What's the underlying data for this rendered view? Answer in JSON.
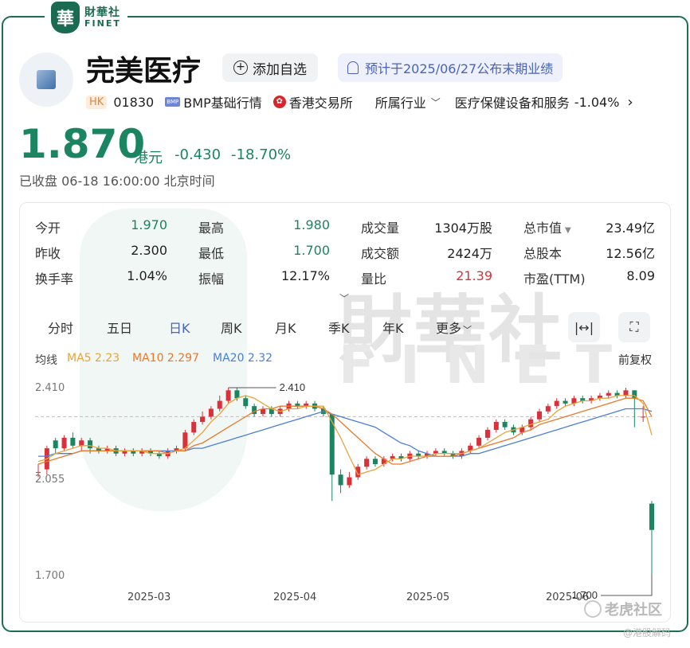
{
  "brand": {
    "seal": "華",
    "cn": "財華社",
    "en": "FINET"
  },
  "stock": {
    "name": "完美医疗",
    "watch_label": "添加自选",
    "notice": "预计于2025/06/27公布末期业绩",
    "market_tag": "HK",
    "code": "01830",
    "bmp_tag": "BMP",
    "bmp_label": "BMP基础行情",
    "exchange": "香港交易所",
    "industry_label": "所属行业",
    "industry": "医疗保健设备和服务",
    "industry_change": "-1.04%",
    "price": "1.870",
    "currency": "港元",
    "change": "-0.430",
    "change_pct": "-18.70%",
    "status": "已收盘  06-18 16:00:00 北京时间"
  },
  "stats": {
    "open_label": "今开",
    "open": "1.970",
    "high_label": "最高",
    "high": "1.980",
    "volume_label": "成交量",
    "volume": "1304万股",
    "mktcap_label": "总市值",
    "mktcap": "23.49亿",
    "prev_label": "昨收",
    "prev": "2.300",
    "low_label": "最低",
    "low": "1.700",
    "turnover_label": "成交额",
    "turnover": "2424万",
    "shares_label": "总股本",
    "shares": "12.56亿",
    "rate_label": "换手率",
    "rate": "1.04%",
    "amp_label": "振幅",
    "amp": "12.17%",
    "vr_label": "量比",
    "vr": "21.39",
    "pe_label": "市盈(TTM)",
    "pe": "8.09"
  },
  "tabs": [
    "分时",
    "五日",
    "日K",
    "周K",
    "月K",
    "季K",
    "年K",
    "更多"
  ],
  "active_tab": "日K",
  "ma": {
    "label": "均线",
    "ma5": "MA5 2.23",
    "ma10": "MA10 2.297",
    "ma20": "MA20 2.32",
    "adjust": "前复权"
  },
  "colors": {
    "up": "#d9303a",
    "down": "#1a8560",
    "ma5": "#e8a33a",
    "ma10": "#e8792a",
    "ma20": "#4a7fd8"
  },
  "chart_data": {
    "type": "candlestick",
    "y_ticks": [
      "2.410",
      "2.055",
      "1.700"
    ],
    "x_ticks": [
      "2025-03",
      "2025-04",
      "2025-05",
      "2025-06"
    ],
    "ylim": [
      1.7,
      2.41
    ],
    "max_label": "2.410",
    "min_label": "1.700",
    "candles": [
      [
        2.09,
        2.09,
        2.12,
        2.07
      ],
      [
        2.1,
        2.18,
        2.19,
        2.08
      ],
      [
        2.21,
        2.18,
        2.22,
        2.16
      ],
      [
        2.18,
        2.22,
        2.23,
        2.17
      ],
      [
        2.22,
        2.19,
        2.24,
        2.18
      ],
      [
        2.19,
        2.21,
        2.22,
        2.17
      ],
      [
        2.21,
        2.18,
        2.22,
        2.16
      ],
      [
        2.18,
        2.17,
        2.19,
        2.16
      ],
      [
        2.17,
        2.18,
        2.19,
        2.16
      ],
      [
        2.18,
        2.16,
        2.19,
        2.15
      ],
      [
        2.16,
        2.17,
        2.18,
        2.15
      ],
      [
        2.17,
        2.16,
        2.18,
        2.15
      ],
      [
        2.16,
        2.17,
        2.18,
        2.15
      ],
      [
        2.17,
        2.16,
        2.18,
        2.15
      ],
      [
        2.16,
        2.15,
        2.17,
        2.14
      ],
      [
        2.15,
        2.17,
        2.18,
        2.14
      ],
      [
        2.17,
        2.18,
        2.19,
        2.16
      ],
      [
        2.18,
        2.24,
        2.25,
        2.17
      ],
      [
        2.24,
        2.28,
        2.29,
        2.23
      ],
      [
        2.28,
        2.3,
        2.32,
        2.27
      ],
      [
        2.3,
        2.33,
        2.34,
        2.29
      ],
      [
        2.33,
        2.36,
        2.38,
        2.32
      ],
      [
        2.36,
        2.4,
        2.41,
        2.35
      ],
      [
        2.4,
        2.37,
        2.41,
        2.36
      ],
      [
        2.37,
        2.34,
        2.38,
        2.33
      ],
      [
        2.34,
        2.31,
        2.35,
        2.3
      ],
      [
        2.31,
        2.33,
        2.34,
        2.3
      ],
      [
        2.33,
        2.31,
        2.34,
        2.3
      ],
      [
        2.31,
        2.33,
        2.34,
        2.3
      ],
      [
        2.33,
        2.35,
        2.36,
        2.32
      ],
      [
        2.35,
        2.34,
        2.36,
        2.33
      ],
      [
        2.34,
        2.35,
        2.36,
        2.33
      ],
      [
        2.35,
        2.33,
        2.36,
        2.32
      ],
      [
        2.33,
        2.31,
        2.34,
        2.3
      ],
      [
        2.31,
        2.08,
        2.31,
        1.98
      ],
      [
        2.08,
        2.04,
        2.1,
        2.01
      ],
      [
        2.04,
        2.07,
        2.09,
        2.03
      ],
      [
        2.07,
        2.11,
        2.12,
        2.06
      ],
      [
        2.11,
        2.14,
        2.15,
        2.1
      ],
      [
        2.14,
        2.12,
        2.15,
        2.11
      ],
      [
        2.12,
        2.14,
        2.15,
        2.11
      ],
      [
        2.14,
        2.15,
        2.16,
        2.13
      ],
      [
        2.15,
        2.14,
        2.16,
        2.13
      ],
      [
        2.14,
        2.16,
        2.17,
        2.13
      ],
      [
        2.16,
        2.15,
        2.17,
        2.14
      ],
      [
        2.15,
        2.16,
        2.17,
        2.14
      ],
      [
        2.16,
        2.17,
        2.18,
        2.15
      ],
      [
        2.17,
        2.16,
        2.18,
        2.15
      ],
      [
        2.16,
        2.15,
        2.17,
        2.14
      ],
      [
        2.15,
        2.17,
        2.18,
        2.14
      ],
      [
        2.17,
        2.19,
        2.2,
        2.16
      ],
      [
        2.19,
        2.22,
        2.23,
        2.18
      ],
      [
        2.22,
        2.25,
        2.26,
        2.21
      ],
      [
        2.25,
        2.28,
        2.29,
        2.24
      ],
      [
        2.28,
        2.26,
        2.29,
        2.25
      ],
      [
        2.26,
        2.24,
        2.27,
        2.23
      ],
      [
        2.24,
        2.26,
        2.27,
        2.23
      ],
      [
        2.26,
        2.29,
        2.3,
        2.25
      ],
      [
        2.29,
        2.32,
        2.33,
        2.28
      ],
      [
        2.32,
        2.34,
        2.35,
        2.31
      ],
      [
        2.34,
        2.36,
        2.37,
        2.33
      ],
      [
        2.36,
        2.35,
        2.37,
        2.34
      ],
      [
        2.35,
        2.37,
        2.38,
        2.34
      ],
      [
        2.37,
        2.36,
        2.38,
        2.35
      ],
      [
        2.36,
        2.37,
        2.38,
        2.35
      ],
      [
        2.37,
        2.38,
        2.39,
        2.36
      ],
      [
        2.38,
        2.39,
        2.4,
        2.37
      ],
      [
        2.39,
        2.38,
        2.4,
        2.37
      ],
      [
        2.38,
        2.4,
        2.41,
        2.37
      ],
      [
        2.4,
        2.37,
        2.4,
        2.26
      ],
      [
        2.3,
        2.3,
        2.34,
        2.28
      ],
      [
        1.97,
        1.87,
        1.98,
        1.7
      ]
    ],
    "ma5": [
      2.13,
      2.14,
      2.16,
      2.17,
      2.18,
      2.19,
      2.19,
      2.18,
      2.18,
      2.17,
      2.17,
      2.17,
      2.17,
      2.16,
      2.16,
      2.16,
      2.17,
      2.18,
      2.21,
      2.24,
      2.28,
      2.31,
      2.35,
      2.37,
      2.38,
      2.37,
      2.35,
      2.33,
      2.32,
      2.33,
      2.33,
      2.34,
      2.34,
      2.34,
      2.28,
      2.22,
      2.15,
      2.08,
      2.09,
      2.1,
      2.12,
      2.14,
      2.14,
      2.15,
      2.15,
      2.15,
      2.16,
      2.16,
      2.16,
      2.16,
      2.17,
      2.18,
      2.2,
      2.22,
      2.24,
      2.25,
      2.26,
      2.27,
      2.28,
      2.29,
      2.32,
      2.34,
      2.35,
      2.36,
      2.36,
      2.37,
      2.37,
      2.38,
      2.38,
      2.38,
      2.35,
      2.23
    ],
    "ma10": [
      2.12,
      2.13,
      2.14,
      2.15,
      2.16,
      2.17,
      2.17,
      2.17,
      2.17,
      2.17,
      2.17,
      2.17,
      2.17,
      2.17,
      2.17,
      2.16,
      2.17,
      2.17,
      2.19,
      2.2,
      2.22,
      2.24,
      2.26,
      2.28,
      2.3,
      2.32,
      2.33,
      2.33,
      2.34,
      2.34,
      2.34,
      2.34,
      2.34,
      2.33,
      2.31,
      2.28,
      2.25,
      2.22,
      2.19,
      2.16,
      2.14,
      2.12,
      2.12,
      2.13,
      2.14,
      2.15,
      2.15,
      2.15,
      2.15,
      2.16,
      2.17,
      2.18,
      2.19,
      2.2,
      2.21,
      2.22,
      2.24,
      2.25,
      2.27,
      2.28,
      2.29,
      2.3,
      2.31,
      2.32,
      2.33,
      2.34,
      2.35,
      2.36,
      2.37,
      2.37,
      2.36,
      2.3
    ],
    "ma20": [
      2.15,
      2.15,
      2.16,
      2.16,
      2.16,
      2.17,
      2.17,
      2.17,
      2.17,
      2.17,
      2.17,
      2.17,
      2.17,
      2.17,
      2.17,
      2.17,
      2.17,
      2.17,
      2.18,
      2.18,
      2.19,
      2.2,
      2.21,
      2.22,
      2.23,
      2.24,
      2.25,
      2.26,
      2.27,
      2.28,
      2.29,
      2.3,
      2.31,
      2.32,
      2.31,
      2.3,
      2.29,
      2.28,
      2.27,
      2.26,
      2.24,
      2.22,
      2.2,
      2.19,
      2.17,
      2.16,
      2.15,
      2.15,
      2.15,
      2.15,
      2.16,
      2.16,
      2.17,
      2.18,
      2.19,
      2.2,
      2.21,
      2.22,
      2.23,
      2.24,
      2.25,
      2.26,
      2.27,
      2.28,
      2.29,
      2.3,
      2.31,
      2.32,
      2.33,
      2.33,
      2.33,
      2.32
    ],
    "prev_close_line": 2.3
  },
  "footer": {
    "community": "老虎社区",
    "user": "@港股解码"
  }
}
